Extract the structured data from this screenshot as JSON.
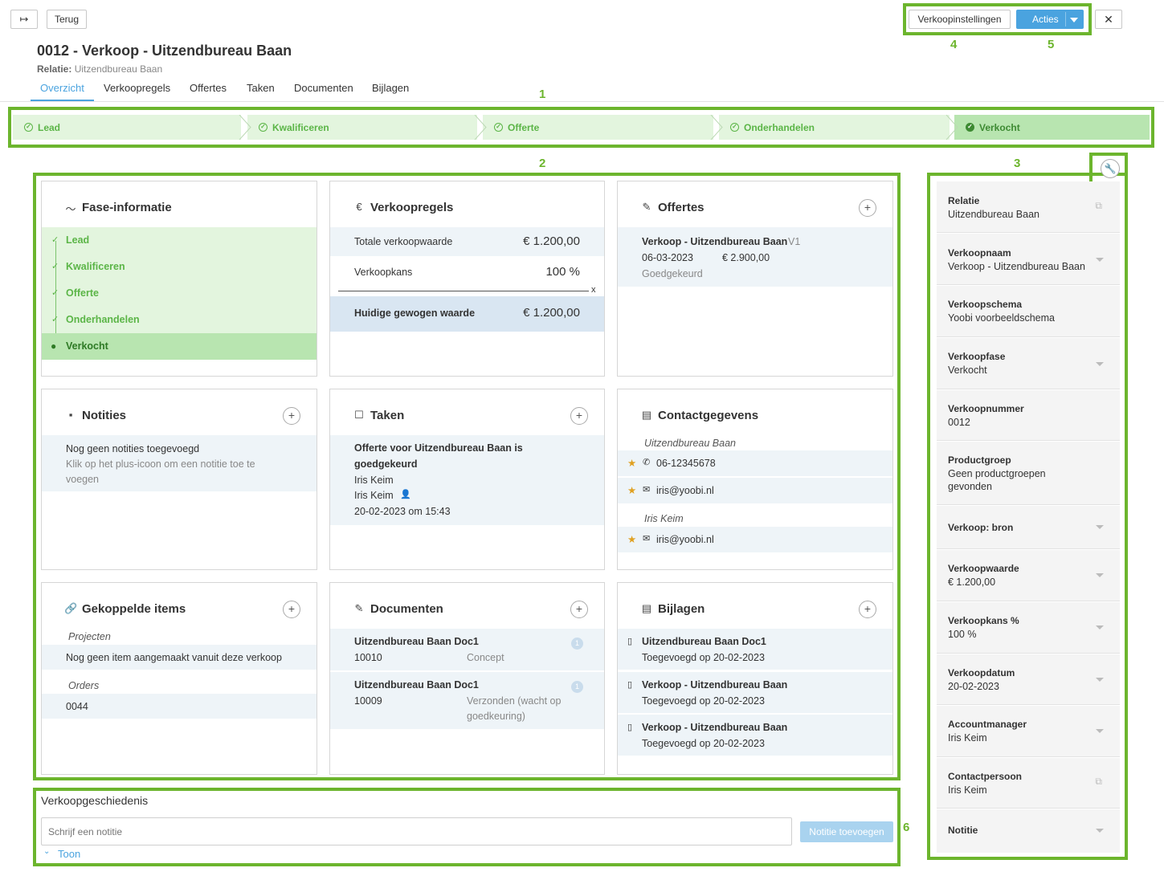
{
  "header": {
    "back_label": "Terug",
    "title": "0012 - Verkoop - Uitzendbureau Baan",
    "relation_label": "Relatie:",
    "relation_value": "Uitzendbureau Baan",
    "settings_label": "Verkoopinstellingen",
    "actions_label": "Acties",
    "close_symbol": "✕",
    "collapse_symbol": "↦"
  },
  "tabs": [
    "Overzicht",
    "Verkoopregels",
    "Offertes",
    "Taken",
    "Documenten",
    "Bijlagen"
  ],
  "pipeline": [
    "Lead",
    "Kwalificeren",
    "Offerte",
    "Onderhandelen",
    "Verkocht"
  ],
  "markers": [
    "1",
    "2",
    "3",
    "4",
    "5",
    "6"
  ],
  "phase_card": {
    "title": "Fase-informatie",
    "stages": [
      "Lead",
      "Kwalificeren",
      "Offerte",
      "Onderhandelen",
      "Verkocht"
    ]
  },
  "sales_lines": {
    "title": "Verkoopregels",
    "total_label": "Totale verkoopwaarde",
    "total_value": "€ 1.200,00",
    "chance_label": "Verkoopkans",
    "chance_value": "100 %",
    "mult": "x",
    "weighted_label": "Huidige gewogen waarde",
    "weighted_value": "€ 1.200,00"
  },
  "quotes": {
    "title": "Offertes",
    "name": "Verkoop - Uitzendbureau Baan",
    "version": "V1",
    "date": "06-03-2023",
    "amount": "€ 2.900,00",
    "status": "Goedgekeurd"
  },
  "notes": {
    "title": "Notities",
    "empty": "Nog geen notities toegevoegd",
    "hint_1": "Klik op het plus-icoon om een notitie toe te",
    "hint_2": "voegen"
  },
  "tasks": {
    "title": "Taken",
    "name_1": "Offerte voor Uitzendbureau Baan is",
    "name_2": "goedgekeurd",
    "person_1": "Iris Keim",
    "person_2": "Iris Keim",
    "date": "20-02-2023 om 15:43"
  },
  "contacts": {
    "title": "Contactgegevens",
    "company": "Uitzendbureau Baan",
    "phone": "06-12345678",
    "email_1": "iris@yoobi.nl",
    "person": "Iris Keim",
    "email_2": "iris@yoobi.nl"
  },
  "linked": {
    "title": "Gekoppelde items",
    "projects_label": "Projecten",
    "projects_empty": "Nog geen item aangemaakt vanuit deze verkoop",
    "orders_label": "Orders",
    "order_value": "0044"
  },
  "documents": {
    "title": "Documenten",
    "items": [
      {
        "name": "Uitzendbureau Baan Doc1",
        "number": "10010",
        "status_1": "Concept",
        "status_2": "",
        "badge": "1"
      },
      {
        "name": "Uitzendbureau Baan Doc1",
        "number": "10009",
        "status_1": "Verzonden (wacht op",
        "status_2": "goedkeuring)",
        "badge": "1"
      }
    ]
  },
  "attachments": {
    "title": "Bijlagen",
    "items": [
      {
        "name": "Uitzendbureau Baan Doc1",
        "added": "Toegevoegd op 20-02-2023"
      },
      {
        "name": "Verkoop - Uitzendbureau Baan",
        "added": "Toegevoegd op 20-02-2023"
      },
      {
        "name": "Verkoop - Uitzendbureau Baan",
        "added": "Toegevoegd op 20-02-2023"
      }
    ]
  },
  "sidebar": [
    {
      "label": "Relatie",
      "value": "Uitzendbureau Baan",
      "value2": ""
    },
    {
      "label": "Verkoopnaam",
      "value": "Verkoop - Uitzendbureau Baan",
      "value2": ""
    },
    {
      "label": "Verkoopschema",
      "value": "Yoobi voorbeeldschema",
      "value2": ""
    },
    {
      "label": "Verkoopfase",
      "value": "Verkocht",
      "value2": ""
    },
    {
      "label": "Verkoopnummer",
      "value": "0012",
      "value2": ""
    },
    {
      "label": "Productgroep",
      "value": "Geen productgroepen",
      "value2": "gevonden"
    },
    {
      "label": "Verkoop: bron",
      "value": "",
      "value2": ""
    },
    {
      "label": "Verkoopwaarde",
      "value": "€ 1.200,00",
      "value2": ""
    },
    {
      "label": "Verkoopkans %",
      "value": "100 %",
      "value2": ""
    },
    {
      "label": "Verkoopdatum",
      "value": "20-02-2023",
      "value2": ""
    },
    {
      "label": "Accountmanager",
      "value": "Iris Keim",
      "value2": ""
    },
    {
      "label": "Contactpersoon",
      "value": "Iris Keim",
      "value2": ""
    },
    {
      "label": "Notitie",
      "value": "",
      "value2": ""
    }
  ],
  "history": {
    "title": "Verkoopgeschiedenis",
    "placeholder": "Schrijf een notitie",
    "add_label": "Notitie toevoegen",
    "show_label": "Toon"
  },
  "colors": {
    "accent": "#6cb52d",
    "primary": "#4aa3df",
    "stage_bg": "#e3f5de",
    "stage_active": "#b8e5b0"
  }
}
